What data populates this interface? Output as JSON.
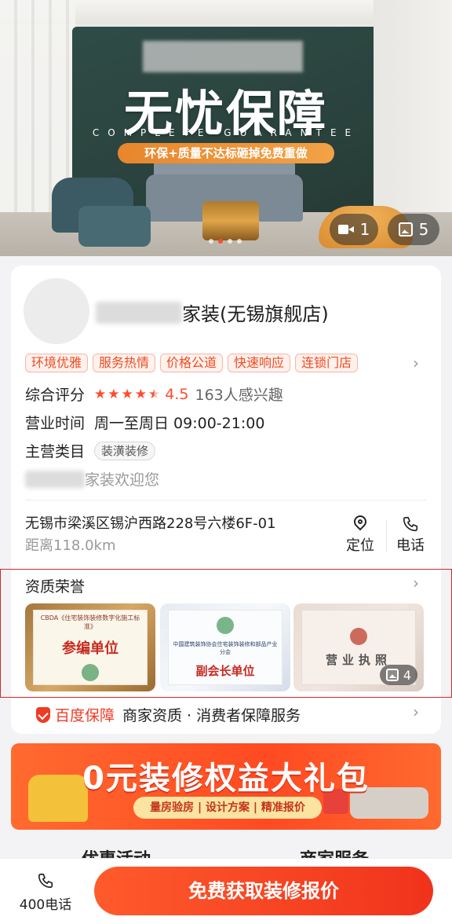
{
  "hero": {
    "title": "无忧保障",
    "subtitle": "COMPLETE GUARANTEE",
    "pill": "环保+质量不达标砸掉免费重做",
    "video_count": "1",
    "photo_count": "5",
    "indicator_count": 4,
    "active_indicator": 1
  },
  "store": {
    "name_suffix": "家装(无锡旗舰店)",
    "tags": [
      "环境优雅",
      "服务热情",
      "价格公道",
      "快速响应",
      "连锁门店"
    ],
    "rating_label": "综合评分",
    "rating": 4.5,
    "rating_text": "4.5",
    "interest": "163人感兴趣",
    "hours_label": "营业时间",
    "hours": "周一至周日 09:00-21:00",
    "category_label": "主营类目",
    "category": "装潢装修",
    "welcome_suffix": "家装欢迎您",
    "address": "无锡市梁溪区锡沪西路228号六楼6F-01",
    "distance": "距离118.0km",
    "locate_label": "定位",
    "call_label": "电话"
  },
  "honors": {
    "title": "资质荣誉",
    "certs": [
      {
        "small": "CBDA《住宅装饰装修数字化施工标准》",
        "big": "参编单位"
      },
      {
        "small": "中国建筑装饰协会住宅装饰装修和部品产业分会",
        "big": "副会长单位"
      },
      {
        "small": "",
        "big": "营业执照"
      }
    ],
    "count": "4"
  },
  "guarantee": {
    "brand": "百度保障",
    "text": "商家资质 · 消费者保障服务"
  },
  "promo": {
    "title": "0元装修权益大礼包",
    "sub": "量房验房 | 设计方案 | 精准报价"
  },
  "sections": {
    "left": "优惠活动",
    "right": "商家服务"
  },
  "bottom_bar": {
    "phone_label": "400电话",
    "cta": "免费获取装修报价"
  },
  "colors": {
    "accent": "#ff4a22",
    "tag_text": "#ef4b22",
    "tag_bg": "#fff1ec",
    "highlight_border": "#d6262a"
  }
}
